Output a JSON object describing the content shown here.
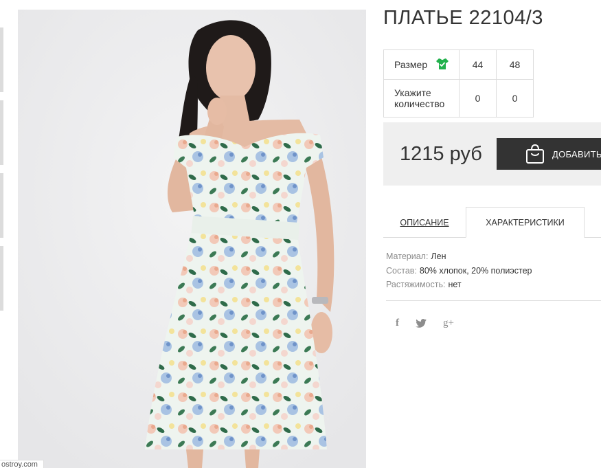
{
  "product": {
    "title": "ПЛАТЬЕ 22104/3"
  },
  "size_table": {
    "size_label": "Размер",
    "sizes": [
      "44",
      "48"
    ],
    "quantity_label": "Укажите количество",
    "quantities": [
      "0",
      "0"
    ]
  },
  "price": {
    "value": "1215 руб",
    "add_button_label": "ДОБАВИТЬ"
  },
  "tabs": [
    {
      "label": "ОПИСАНИЕ",
      "active": false
    },
    {
      "label": "ХАРАКТЕРИСТИКИ",
      "active": true
    }
  ],
  "characteristics": [
    {
      "key": "Материал:",
      "value": "Лен"
    },
    {
      "key": "Состав:",
      "value": "80% хлопок, 20% полиэстер"
    },
    {
      "key": "Растяжимость:",
      "value": "нет"
    }
  ],
  "social": {
    "icons": [
      "facebook-icon",
      "twitter-icon",
      "google-plus-icon"
    ],
    "facebook_glyph": "f",
    "twitter_glyph": "t",
    "google_glyph": "g+"
  },
  "status_bar": {
    "link_text": "ostroy.com"
  },
  "colors": {
    "button_bg": "#333333",
    "price_block_bg": "#efefef",
    "size_icon_green": "#22b14c"
  }
}
